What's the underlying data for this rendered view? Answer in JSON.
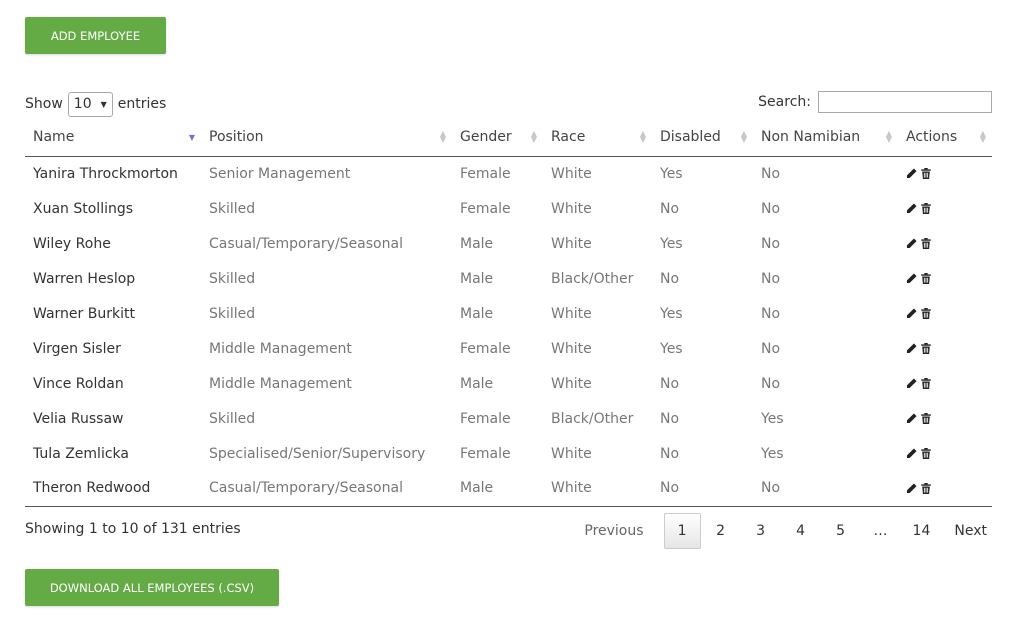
{
  "buttons": {
    "add_employee": "ADD EMPLOYEE",
    "download_csv": "DOWNLOAD ALL EMPLOYEES (.CSV)"
  },
  "length": {
    "show": "Show",
    "value": "10",
    "entries": "entries"
  },
  "search": {
    "label": "Search:",
    "value": ""
  },
  "table": {
    "columns": [
      "Name",
      "Position",
      "Gender",
      "Race",
      "Disabled",
      "Non Namibian",
      "Actions"
    ],
    "rows": [
      [
        "Yanira Throckmorton",
        "Senior Management",
        "Female",
        "White",
        "Yes",
        "No"
      ],
      [
        "Xuan Stollings",
        "Skilled",
        "Female",
        "White",
        "No",
        "No"
      ],
      [
        "Wiley Rohe",
        "Casual/Temporary/Seasonal",
        "Male",
        "White",
        "Yes",
        "No"
      ],
      [
        "Warren Heslop",
        "Skilled",
        "Male",
        "Black/Other",
        "No",
        "No"
      ],
      [
        "Warner Burkitt",
        "Skilled",
        "Male",
        "White",
        "Yes",
        "No"
      ],
      [
        "Virgen Sisler",
        "Middle Management",
        "Female",
        "White",
        "Yes",
        "No"
      ],
      [
        "Vince Roldan",
        "Middle Management",
        "Male",
        "White",
        "No",
        "No"
      ],
      [
        "Velia Russaw",
        "Skilled",
        "Female",
        "Black/Other",
        "No",
        "Yes"
      ],
      [
        "Tula Zemlicka",
        "Specialised/Senior/Supervisory",
        "Female",
        "White",
        "No",
        "Yes"
      ],
      [
        "Theron Redwood",
        "Casual/Temporary/Seasonal",
        "Male",
        "White",
        "No",
        "No"
      ]
    ]
  },
  "info": "Showing 1 to 10 of 131 entries",
  "pagination": {
    "previous": "Previous",
    "pages": [
      "1",
      "2",
      "3",
      "4",
      "5",
      "…",
      "14"
    ],
    "current": "1",
    "next": "Next"
  },
  "colors": {
    "accent_green": "#65ab45",
    "sort_active": "#7b6fcf"
  },
  "icons": {
    "edit": "pencil-icon",
    "delete": "trash-icon"
  }
}
